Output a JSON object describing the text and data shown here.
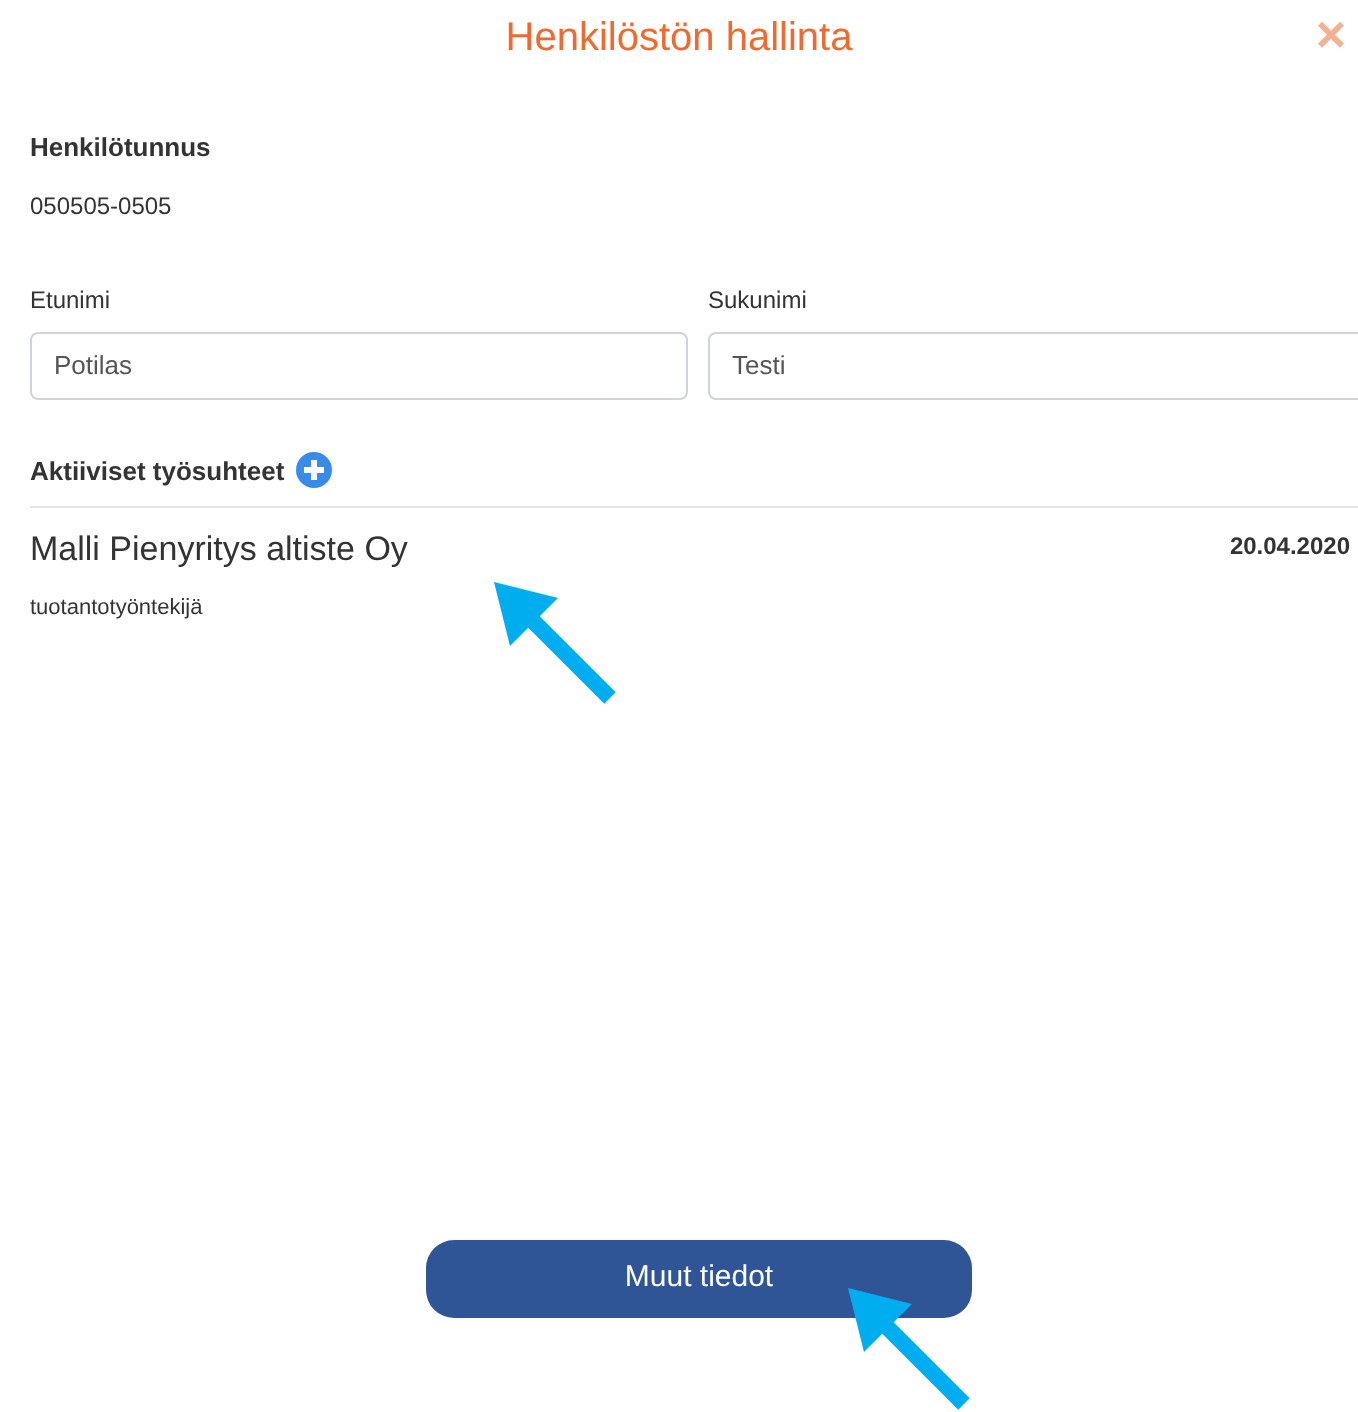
{
  "title": "Henkilöstön hallinta",
  "close_icon": "×",
  "id_field": {
    "label": "Henkilötunnus",
    "value": "050505-0505"
  },
  "first_name": {
    "label": "Etunimi",
    "value": "Potilas"
  },
  "last_name": {
    "label": "Sukunimi",
    "value": "Testi"
  },
  "employments": {
    "heading": "Aktiiviset työsuhteet",
    "items": [
      {
        "company": "Malli Pienyritys altiste Oy",
        "role": "tuotantotyöntekijä",
        "date": "20.04.2020"
      }
    ]
  },
  "button": "Muut tiedot"
}
